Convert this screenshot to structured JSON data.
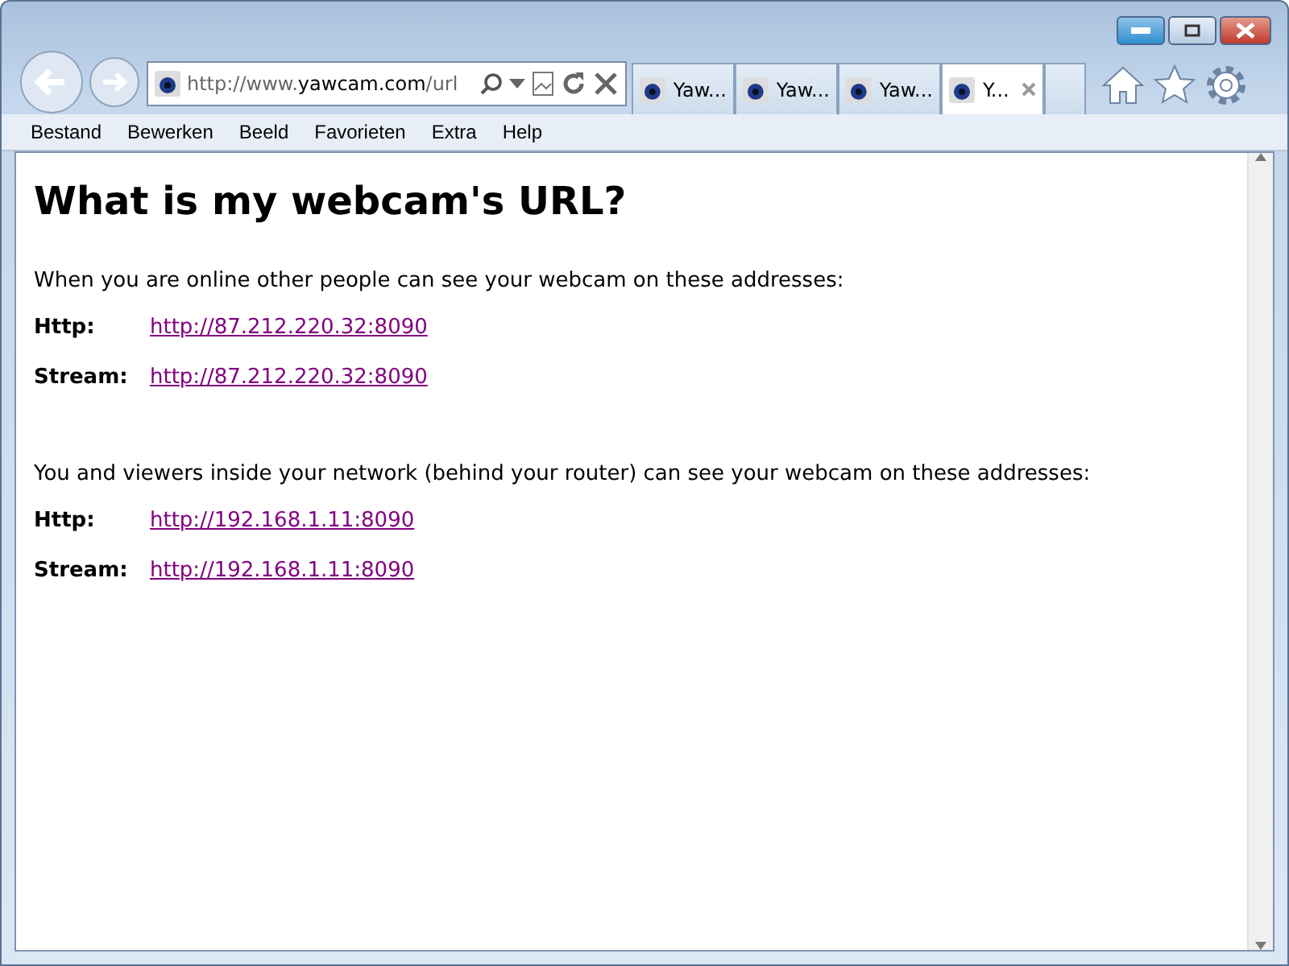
{
  "address_bar": {
    "value": "http://www.**yawcam.com**/url"
  },
  "tabs": [
    {
      "title": "Yaw...",
      "selected": false
    },
    {
      "title": "Yaw...",
      "selected": false
    },
    {
      "title": "Yaw...",
      "selected": false
    },
    {
      "title": "Y...",
      "selected": true
    }
  ],
  "menu": [
    "Bestand",
    "Bewerken",
    "Beeld",
    "Favorieten",
    "Extra",
    "Help"
  ],
  "page": {
    "heading": "What is my webcam's URL?",
    "sections": [
      {
        "intro": "When you are online other people can see your webcam on these addresses:",
        "rows": [
          {
            "label": "Http:",
            "link": "http://87.212.220.32:8090"
          },
          {
            "label": "Stream:",
            "link": "http://87.212.220.32:8090"
          }
        ]
      },
      {
        "intro": "You and viewers inside your network (behind your router) can see your webcam on these addresses:",
        "rows": [
          {
            "label": "Http:",
            "link": "http://192.168.1.11:8090"
          },
          {
            "label": "Stream:",
            "link": "http://192.168.1.11:8090"
          }
        ]
      }
    ]
  }
}
